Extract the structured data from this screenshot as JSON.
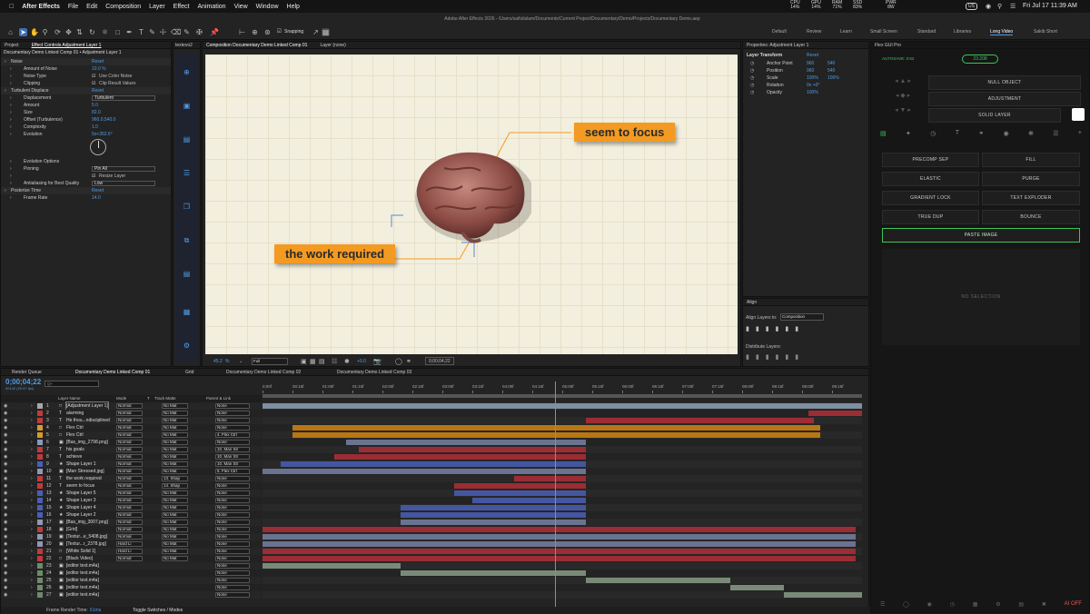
{
  "mac_menu": {
    "app": "After Effects",
    "items": [
      "File",
      "Edit",
      "Composition",
      "Layer",
      "Effect",
      "Animation",
      "View",
      "Window",
      "Help"
    ],
    "stats": [
      {
        "v": "14%",
        "l": "CPU"
      },
      {
        "v": "14%",
        "l": "GPU"
      },
      {
        "v": "71%",
        "l": "RAM"
      },
      {
        "v": "83%",
        "l": "SSD"
      },
      {
        "v": "8W",
        "l": "PWR"
      }
    ],
    "lang": "US",
    "clock": "Fri Jul 17  11:39 AM"
  },
  "window_title": "Adobe After Effects 2026 - /Users/saifulislam/Documents/Current Project/Documentary/Demo/Projects/Documentary Demo.aep",
  "toolbar": {
    "snapping": "Snapping",
    "workspaces": [
      "Default",
      "Review",
      "Learn",
      "Small Screen",
      "Standard",
      "Libraries",
      "Long Video",
      "Sakib Short"
    ],
    "active_workspace": "Long Video"
  },
  "project_panel": {
    "tabs": [
      "Project",
      "Effect Controls Adjustment Layer 1"
    ],
    "subtitle": "Documentary Demo Linked Comp 01 • Adjustment Layer 1",
    "rows": [
      {
        "name": "Noise",
        "value": "Reset",
        "indent": 0,
        "fx": true
      },
      {
        "name": "Amount of Noise",
        "value": "10.0 %",
        "indent": 1
      },
      {
        "name": "Noise Type",
        "value": "Use Color Noise",
        "indent": 1,
        "check": true
      },
      {
        "name": "Clipping",
        "value": "Clip Result Values",
        "indent": 1,
        "check": true
      },
      {
        "name": "Turbulent Displace",
        "value": "Reset",
        "indent": 0,
        "fx": true
      },
      {
        "name": "Displacement",
        "value": "Turbulent",
        "indent": 1,
        "dd": true
      },
      {
        "name": "Amount",
        "value": "5.0",
        "indent": 1
      },
      {
        "name": "Size",
        "value": "82.0",
        "indent": 1
      },
      {
        "name": "Offset (Turbulence)",
        "value": "960.0,540.0",
        "indent": 1
      },
      {
        "name": "Complexity",
        "value": "1.0",
        "indent": 1
      },
      {
        "name": "Evolution",
        "value": "5x+352.6°",
        "indent": 1
      }
    ],
    "rows2": [
      {
        "name": "Evolution Options",
        "value": "",
        "indent": 1
      },
      {
        "name": "Pinning",
        "value": "Pin All",
        "indent": 1,
        "dd": true
      },
      {
        "name": "",
        "value": "Resize Layer",
        "indent": 1,
        "check": true
      },
      {
        "name": "Antialiasing for Best Quality",
        "value": "Low",
        "indent": 1,
        "dd": true
      },
      {
        "name": "Posterize Time",
        "value": "Reset",
        "indent": 0,
        "fx": true
      },
      {
        "name": "Frame Rate",
        "value": "14.0",
        "indent": 1
      }
    ]
  },
  "side_panel_tab": "textevo2",
  "comp_panel": {
    "tab": "Composition Documentary Demo Linked Comp 01",
    "layer_tab": "Layer (none)",
    "label1": "seem to focus",
    "label2": "the work required",
    "zoom": "45.2",
    "quality": "Full",
    "exposure": "+0.0",
    "timecode": "0;00;04;22"
  },
  "properties": {
    "title": "Properties: Adjustment Layer 1",
    "section": "Layer Transform",
    "reset": "Reset",
    "rows": [
      {
        "name": "Anchor Point",
        "v1": "960",
        "v2": "540"
      },
      {
        "name": "Position",
        "v1": "960",
        "v2": "540"
      },
      {
        "name": "Scale",
        "v1": "100%",
        "v2": "100%"
      },
      {
        "name": "Rotation",
        "v1": "0x +0°",
        "v2": ""
      },
      {
        "name": "Opacity",
        "v1": "100%",
        "v2": ""
      }
    ]
  },
  "align": {
    "title": "Align",
    "align_to_label": "Align Layers to:",
    "align_to": "Composition",
    "distribute": "Distribute Layers:"
  },
  "flex": {
    "title": "Flex GUI Pro",
    "autosave": "AUTOSAVE: 0:52",
    "version": "23.208",
    "buttons_right": [
      "NULL OBJECT",
      "ADJUSTMENT",
      "SOLID LAYER"
    ],
    "grid_buttons": [
      "PRECOMP SEP",
      "FILL",
      "ELASTIC",
      "PURGE",
      "GRADIENT LOCK",
      "TEXT EXPLODER",
      "TRUE DUP",
      "BOUNCE"
    ],
    "paste": "PASTE IMAGE",
    "no_selection": "NO SELECTION",
    "footer": "AI OFF"
  },
  "timeline": {
    "tabs": [
      "Render Queue",
      "Documentary Demo Linked Comp 01",
      "Grid",
      "Documentary Demo Linked Comp 02",
      "Documentary Demo Linked Comp 03"
    ],
    "timecode": "0;00;04;22",
    "timecode_sub": "00142 (29.97 fps)",
    "search_placeholder": "Q+",
    "headers": {
      "name": "Layer Name",
      "mode": "Mode",
      "t": "T",
      "matte": "Track Matte",
      "parent": "Parent & Link"
    },
    "ticks": [
      "0;00f",
      "00:15f",
      "01:00f",
      "01:15f",
      "02:00f",
      "02:15f",
      "03:00f",
      "03:15f",
      "04:00f",
      "04:15f",
      "05:00f",
      "05:15f",
      "06:00f",
      "06:15f",
      "07:00f",
      "07:15f",
      "08:00f",
      "08:15f",
      "09:00f",
      "09:15f"
    ],
    "layers": [
      {
        "n": "1",
        "name": "[Adjustment Layer 1]",
        "c": "#a7a7a7",
        "mode": "Normal",
        "matte": "No Mat",
        "parent": "None",
        "bar": "#7d8fa0",
        "s": 0,
        "e": 100,
        "type": "box"
      },
      {
        "n": "2",
        "name": "alarming",
        "c": "#c03a3a",
        "mode": "Normal",
        "matte": "No Mat",
        "parent": "None",
        "bar": "#9b2d34",
        "s": 91,
        "e": 100,
        "type": "T"
      },
      {
        "n": "3",
        "name": "He thou...ndisciplined",
        "c": "#c03a3a",
        "mode": "Normal",
        "matte": "No Mat",
        "parent": "None",
        "bar": "#9b2d34",
        "s": 54,
        "e": 92,
        "type": "T"
      },
      {
        "n": "4",
        "name": "Flex Ctrl",
        "c": "#d89a2a",
        "mode": "Normal",
        "matte": "No Mat",
        "parent": "None",
        "bar": "#b87714",
        "s": 5,
        "e": 93,
        "type": "box"
      },
      {
        "n": "5",
        "name": "Flex Ctrl",
        "c": "#d89a2a",
        "mode": "Normal",
        "matte": "No Mat",
        "parent": "4. Flex Ctrl",
        "bar": "#b87714",
        "s": 5,
        "e": 93,
        "type": "box"
      },
      {
        "n": "6",
        "name": "[Bas_img_2798.png]",
        "c": "#8f98b4",
        "mode": "Normal",
        "matte": "No Mat",
        "parent": "None",
        "bar": "#6a7390",
        "s": 14,
        "e": 54,
        "type": "img"
      },
      {
        "n": "7",
        "name": "his goals",
        "c": "#c03a3a",
        "mode": "Normal",
        "matte": "No Mat",
        "parent": "10. Man Str",
        "bar": "#9b2d34",
        "s": 16,
        "e": 54,
        "type": "T"
      },
      {
        "n": "8",
        "name": "achieve",
        "c": "#c03a3a",
        "mode": "Normal",
        "matte": "No Mat",
        "parent": "10. Man Str",
        "bar": "#9b2d34",
        "s": 12,
        "e": 54,
        "type": "T"
      },
      {
        "n": "9",
        "name": "Shape Layer 1",
        "c": "#4a5fb3",
        "mode": "Normal",
        "matte": "No Mat",
        "parent": "10. Man Str",
        "bar": "#4556a0",
        "s": 3,
        "e": 54,
        "type": "star"
      },
      {
        "n": "10",
        "name": "[Man Stressed.jpg]",
        "c": "#8f98b4",
        "mode": "Normal",
        "matte": "No Mat",
        "parent": "5. Flex Ctrl",
        "bar": "#6a7390",
        "s": 0,
        "e": 54,
        "type": "img"
      },
      {
        "n": "11",
        "name": "the work required",
        "c": "#c03a3a",
        "mode": "Normal",
        "matte": "13. Shap",
        "parent": "None",
        "bar": "#9b2d34",
        "s": 42,
        "e": 54,
        "type": "T"
      },
      {
        "n": "12",
        "name": "seem to focus",
        "c": "#c03a3a",
        "mode": "Normal",
        "matte": "14. Shap",
        "parent": "None",
        "bar": "#9b2d34",
        "s": 32,
        "e": 54,
        "type": "T"
      },
      {
        "n": "13",
        "name": "Shape Layer 5",
        "c": "#4a5fb3",
        "mode": "Normal",
        "matte": "No Mat",
        "parent": "None",
        "bar": "#4556a0",
        "s": 32,
        "e": 54,
        "type": "star"
      },
      {
        "n": "14",
        "name": "Shape Layer 3",
        "c": "#4a5fb3",
        "mode": "Normal",
        "matte": "No Mat",
        "parent": "None",
        "bar": "#4556a0",
        "s": 35,
        "e": 54,
        "type": "star"
      },
      {
        "n": "15",
        "name": "Shape Layer 4",
        "c": "#4a5fb3",
        "mode": "Normal",
        "matte": "No Mat",
        "parent": "None",
        "bar": "#4556a0",
        "s": 23,
        "e": 54,
        "type": "star"
      },
      {
        "n": "16",
        "name": "Shape Layer 2",
        "c": "#4a5fb3",
        "mode": "Normal",
        "matte": "No Mat",
        "parent": "None",
        "bar": "#4556a0",
        "s": 23,
        "e": 54,
        "type": "star"
      },
      {
        "n": "17",
        "name": "[Bas_img_3007.png]",
        "c": "#8f98b4",
        "mode": "Normal",
        "matte": "No Mat",
        "parent": "None",
        "bar": "#6a7390",
        "s": 23,
        "e": 54,
        "type": "img"
      },
      {
        "n": "18",
        "name": "[Grid]",
        "c": "#c03a3a",
        "mode": "Normal",
        "matte": "No Mat",
        "parent": "None",
        "bar": "#9b2d34",
        "s": 0,
        "e": 99,
        "type": "img"
      },
      {
        "n": "19",
        "name": "[Textur...e_5408.jpg]",
        "c": "#8f98b4",
        "mode": "Normal",
        "matte": "No Mat",
        "parent": "None",
        "bar": "#6a7390",
        "s": 0,
        "e": 99,
        "type": "img"
      },
      {
        "n": "20",
        "name": "[Textur...r_2378.jpg]",
        "c": "#8f98b4",
        "mode": "Hard Li",
        "matte": "No Mat",
        "parent": "None",
        "bar": "#6a7390",
        "s": 0,
        "e": 99,
        "type": "img"
      },
      {
        "n": "21",
        "name": "[White Solid 1]",
        "c": "#c03a3a",
        "mode": "Hard Li",
        "matte": "No Mat",
        "parent": "None",
        "bar": "#9b2d34",
        "s": 0,
        "e": 99,
        "type": "box"
      },
      {
        "n": "22",
        "name": "[Black Video]",
        "c": "#c03a3a",
        "mode": "Normal",
        "matte": "No Mat",
        "parent": "None",
        "bar": "#9b2d34",
        "s": 0,
        "e": 99,
        "type": "box"
      },
      {
        "n": "23",
        "name": "[editor text.m4a]",
        "c": "#6e8a6a",
        "mode": "",
        "matte": "",
        "parent": "None",
        "bar": "#7a8a78",
        "s": 0,
        "e": 23,
        "type": "img"
      },
      {
        "n": "24",
        "name": "[editor text.m4a]",
        "c": "#6e8a6a",
        "mode": "",
        "matte": "",
        "parent": "None",
        "bar": "#7a8a78",
        "s": 23,
        "e": 54,
        "type": "img"
      },
      {
        "n": "25",
        "name": "[editor text.m4a]",
        "c": "#6e8a6a",
        "mode": "",
        "matte": "",
        "parent": "None",
        "bar": "#7a8a78",
        "s": 54,
        "e": 78,
        "type": "img"
      },
      {
        "n": "26",
        "name": "[editor text.m4a]",
        "c": "#6e8a6a",
        "mode": "",
        "matte": "",
        "parent": "None",
        "bar": "#7a8a78",
        "s": 78,
        "e": 87,
        "type": "img"
      },
      {
        "n": "27",
        "name": "[editor text.m4a]",
        "c": "#6e8a6a",
        "mode": "",
        "matte": "",
        "parent": "None",
        "bar": "#7a8a78",
        "s": 87,
        "e": 100,
        "type": "img"
      }
    ],
    "playhead_pct": 48.8,
    "render_time_label": "Frame Render Time:",
    "render_time": "61ms",
    "toggle": "Toggle Switches / Modes"
  }
}
